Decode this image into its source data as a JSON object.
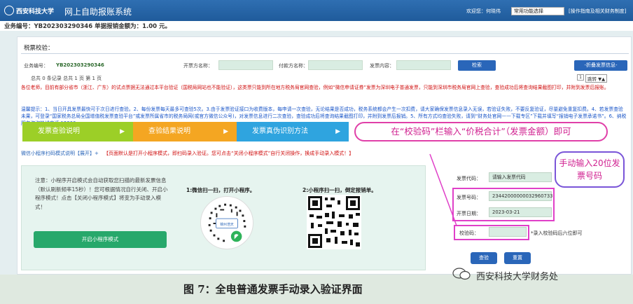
{
  "header": {
    "logo_text": "西安科技大学",
    "system_name": "网上自助报账系统",
    "welcome": "欢迎您：何晓伟",
    "func_select": "常用功能选择",
    "help_link": "[操作指南及相关财务制度]"
  },
  "biz": {
    "label": "业务编号：YB202303290346   单据报销金额为：1.00 元。"
  },
  "panel": {
    "title": "税票校验：",
    "biz_no_label": "业务编号：",
    "biz_no_value": "YB202303290346",
    "issuer_label": "开票方名称：",
    "payer_label": "付款方名称：",
    "content_label": "发票内容：",
    "query_btn": "检索",
    "reset_btn": "-折叠发票信息-",
    "stats": "总共 0   条记录 总共 1 页   第 1 页",
    "page_input": "1",
    "page_go": "跳转 ▼▲"
  },
  "notice": {
    "red": "各位老师，目前有部分省市（浙江、广东）的试点票据无法通过本平台验证（国税局网站也不能验证），这类票只能到所在地方税务局官网查验，例如“微信申请证券”发票为深圳电子普通发票，只能到深圳市税务局官网上查验，查验成功后将查询结果截图打印，并附到发票后报账。",
    "blue": "温馨提示：1、当日开具发票最快可于次日进行查验。2、每份发票每天最多可查验5次。3.由于发票验证接口为收费版本，每申请一次查验，无论结果是否成功，税务系统都会产生一次扣费，请大家确保发票信息录入无误，若验证失败，不要反复验证，尽量避免重复扣费。4、若发票查验未果，可登录“国家税务总局全国增值税发票查验平台”或发票所属省市的税务局网(或官方微信公众号)，对发票信息进行二次查验，查验成功后将查询结果截图打印，并附到发票后报销。5、所有方式均查验失败，请到“财务处官网——下载专区”下载并填写“报销电子发票承诺书”。6、纳税服务咨询热线电话:12366。"
  },
  "tabs": [
    {
      "label": "发票查验说明"
    },
    {
      "label": "查验结果说明"
    },
    {
      "label": "发票真伪识别方法"
    }
  ],
  "callout1": "在“校验码”栏输入“价税合计”（发票金额）即可",
  "mini": {
    "title": "微信小程序扫码模式说明【展开】+",
    "warn": "【页面默认是打开小程序模式，即扫码录入验证。您可点击“关闭小程序模式”自行关闭操作，换成手动录入模式！】",
    "note": "注意：小程序开启模式会自动获取您扫描的最新发票信息（默认刷新频率15秒）！您可根据情况自行关闭、开启小程序模式！点击【关闭小程序模式】将变为手动录入模式！",
    "button": "开启小程序模式",
    "step1": "1:微信扫一扫，打开小程序。",
    "step2": "2:小程序扫一扫，倒定报销单。",
    "qr1_text": "锦州浩天"
  },
  "form": {
    "code_label": "发票代码：",
    "code_value": "请输入发票代码",
    "number_label": "发票号码：",
    "number_value": "23442000000032960733",
    "date_label": "开票日期：",
    "date_value": "2023-03-21",
    "check_label": "校验码：",
    "check_hint": "*录入校验码后六位即可",
    "check_btn": "查验",
    "reset_btn": "重置"
  },
  "callout2": "手动输入20位发票号码",
  "caption": "图 7：全电普通发票手动录入验证界面",
  "watermark": "西安科技大学财务处",
  "colors": {
    "header": "#1f5b9b",
    "tab1": "#9ccf27",
    "tab2": "#f4a622",
    "tab3": "#2fa4df",
    "highlight": "#e040c8"
  }
}
